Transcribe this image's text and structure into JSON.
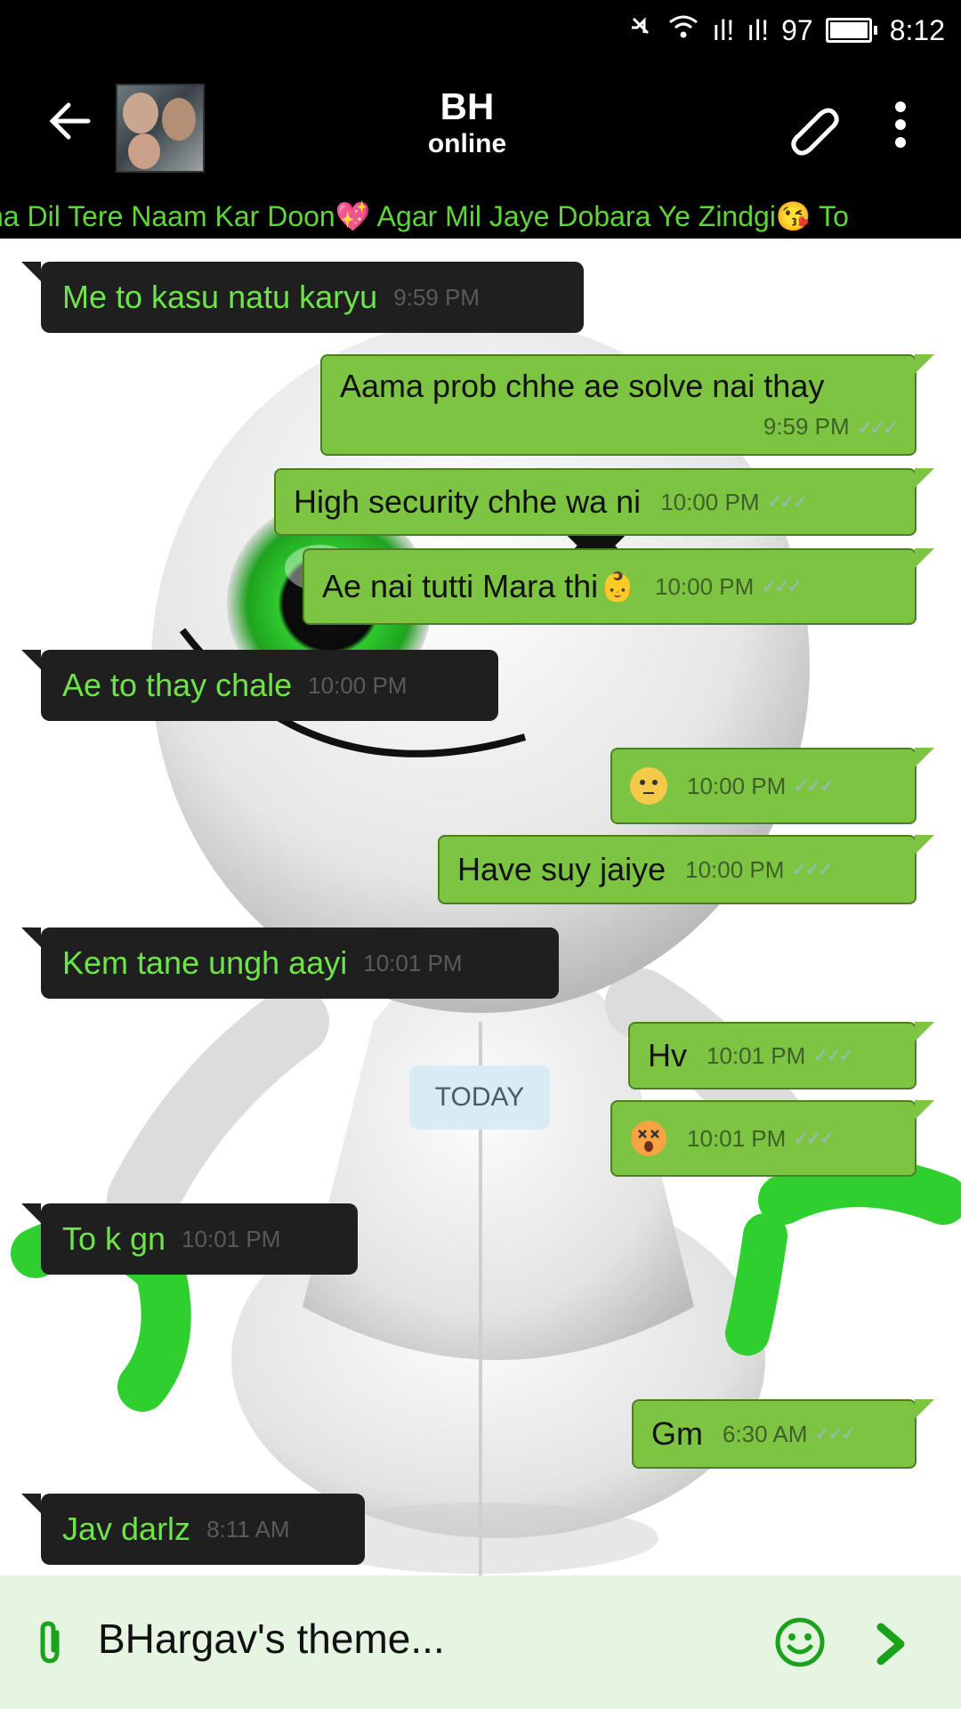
{
  "status_bar": {
    "signal1": "ıl!",
    "signal2": "ıl!",
    "battery": "97",
    "time": "8:12"
  },
  "header": {
    "contact_name": "BH",
    "contact_status": "online"
  },
  "marquee_text": "na Dil Tere Naam Kar Doon💖 Agar Mil Jaye Dobara Ye Zindgi😘 To",
  "messages": [
    {
      "dir": "in",
      "text": "Me to kasu natu karyu",
      "time": "9:59 PM"
    },
    {
      "dir": "out",
      "text": "Aama prob chhe ae solve nai thay",
      "time": "9:59 PM"
    },
    {
      "dir": "out",
      "text": "High security chhe wa ni",
      "time": "10:00 PM"
    },
    {
      "dir": "out",
      "text": "Ae nai tutti Mara thi",
      "time": "10:00 PM"
    },
    {
      "dir": "in",
      "text": "Ae to thay chale",
      "time": "10:00 PM"
    },
    {
      "dir": "out",
      "text": "",
      "time": "10:00 PM"
    },
    {
      "dir": "out",
      "text": "Have suy jaiye",
      "time": "10:00 PM"
    },
    {
      "dir": "in",
      "text": "Kem tane ungh aayi",
      "time": "10:01 PM"
    },
    {
      "dir": "out",
      "text": "Hv",
      "time": "10:01 PM"
    },
    {
      "dir": "out",
      "text": "",
      "time": "10:01 PM"
    },
    {
      "dir": "in",
      "text": "To k gn",
      "time": "10:01 PM"
    },
    {
      "dir": "out",
      "text": "Gm",
      "time": "6:30 AM"
    },
    {
      "dir": "in",
      "text": "Jav darlz",
      "time": "8:11 AM"
    }
  ],
  "date_divider": "TODAY",
  "input": {
    "placeholder": "BHargav's theme..."
  },
  "icons": {
    "back": "back-arrow-icon",
    "attach": "paperclip-icon",
    "menu": "more-vert-icon",
    "emoji": "smiley-icon",
    "send": "send-chevron-icon",
    "wifi": "wifi-icon",
    "mute": "mute-icon"
  },
  "colors": {
    "incoming_bg": "#1f1f1f",
    "incoming_text": "#6ee44a",
    "outgoing_bg": "#7dc443",
    "header": "#000000",
    "input_bar": "#e6f4e2"
  }
}
